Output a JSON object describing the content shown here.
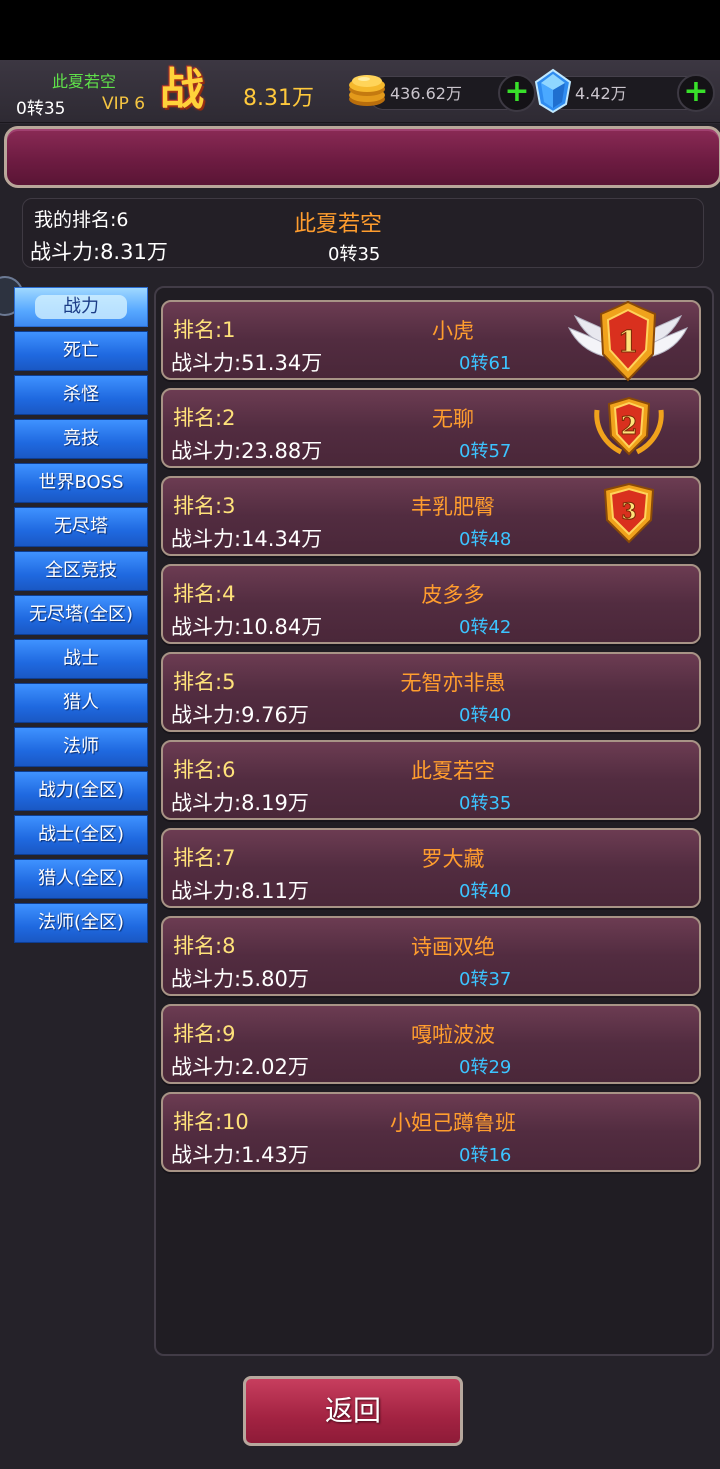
{
  "topbar": {
    "player_name": "此夏若空",
    "player_level": "0转35",
    "vip": "VIP 6",
    "power_icon_text": "战",
    "power_value": "8.31万",
    "gold_value": "436.62万",
    "gem_value": "4.42万",
    "plus_symbol": "+",
    "gold_icon": "gold-coins-icon",
    "gem_icon": "diamond-icon"
  },
  "my_rank": {
    "rank_label": "我的排名:6",
    "power_label": "战斗力:8.31万",
    "name": "此夏若空",
    "level": "0转35"
  },
  "tabs": [
    {
      "label": "战力",
      "active": true
    },
    {
      "label": "死亡"
    },
    {
      "label": "杀怪"
    },
    {
      "label": "竞技"
    },
    {
      "label": "世界BOSS"
    },
    {
      "label": "无尽塔"
    },
    {
      "label": "全区竞技"
    },
    {
      "label": "无尽塔(全区)"
    },
    {
      "label": "战士"
    },
    {
      "label": "猎人"
    },
    {
      "label": "法师"
    },
    {
      "label": "战力(全区)"
    },
    {
      "label": "战士(全区)"
    },
    {
      "label": "猎人(全区)"
    },
    {
      "label": "法师(全区)"
    }
  ],
  "rankings": [
    {
      "rank": "排名:1",
      "power": "战斗力:51.34万",
      "name": "小虎",
      "level": "0转61",
      "medal": "1"
    },
    {
      "rank": "排名:2",
      "power": "战斗力:23.88万",
      "name": "无聊",
      "level": "0转57",
      "medal": "2"
    },
    {
      "rank": "排名:3",
      "power": "战斗力:14.34万",
      "name": "丰乳肥臀",
      "level": "0转48",
      "medal": "3"
    },
    {
      "rank": "排名:4",
      "power": "战斗力:10.84万",
      "name": "皮多多",
      "level": "0转42"
    },
    {
      "rank": "排名:5",
      "power": "战斗力:9.76万",
      "name": "无智亦非愚",
      "level": "0转40"
    },
    {
      "rank": "排名:6",
      "power": "战斗力:8.19万",
      "name": "此夏若空",
      "level": "0转35"
    },
    {
      "rank": "排名:7",
      "power": "战斗力:8.11万",
      "name": "罗大藏",
      "level": "0转40"
    },
    {
      "rank": "排名:8",
      "power": "战斗力:5.80万",
      "name": "诗画双绝",
      "level": "0转37"
    },
    {
      "rank": "排名:9",
      "power": "战斗力:2.02万",
      "name": "嘎啦波波",
      "level": "0转29"
    },
    {
      "rank": "排名:10",
      "power": "战斗力:1.43万",
      "name": "小妲己蹲鲁班",
      "level": "0转16"
    }
  ],
  "back_button": "返回",
  "colors": {
    "rank_label": "#ffe27a",
    "name": "#ff9d2e",
    "level": "#3cc4ff",
    "tab": "#1f69e0",
    "banner": "#6e1c42"
  }
}
